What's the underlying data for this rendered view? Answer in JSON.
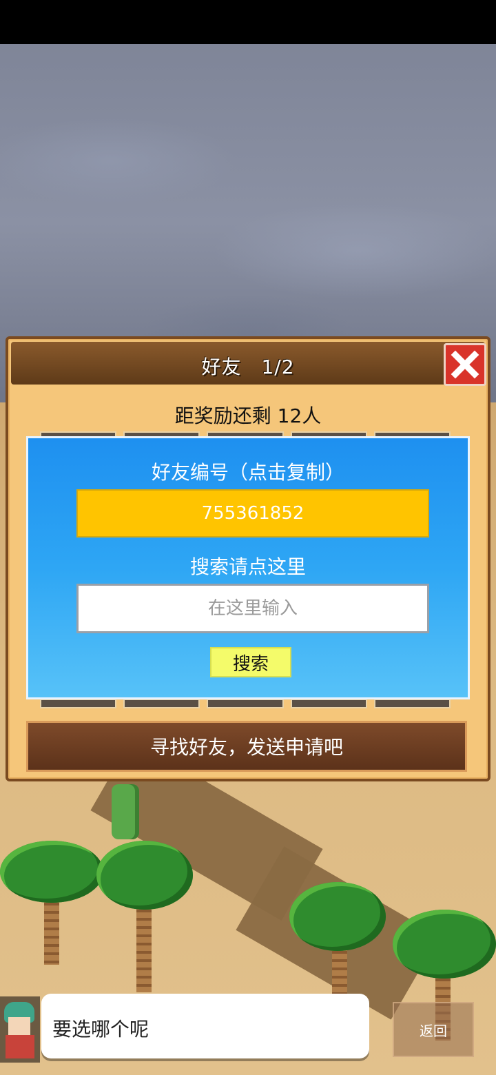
{
  "dialog": {
    "title": "好友　1/2",
    "reward_text": "距奖励还剩 12人",
    "close_icon": "close-x-icon",
    "panel": {
      "friend_id_label": "好友编号（点击复制）",
      "friend_id_value": "755361852",
      "search_label": "搜索请点这里",
      "search_placeholder": "在这里输入",
      "search_button": "搜索"
    },
    "find_button": "寻找好友，发送申请吧"
  },
  "speech": {
    "text": "要选哪个呢"
  },
  "back_button": "返回",
  "colors": {
    "panel_blue": "#1e90f0",
    "id_box_yellow": "#ffc400",
    "search_btn_yellow": "#f4fb6a",
    "close_red": "#d9332a",
    "dialog_tan": "#f5c67a",
    "header_brown": "#5e3a18"
  }
}
